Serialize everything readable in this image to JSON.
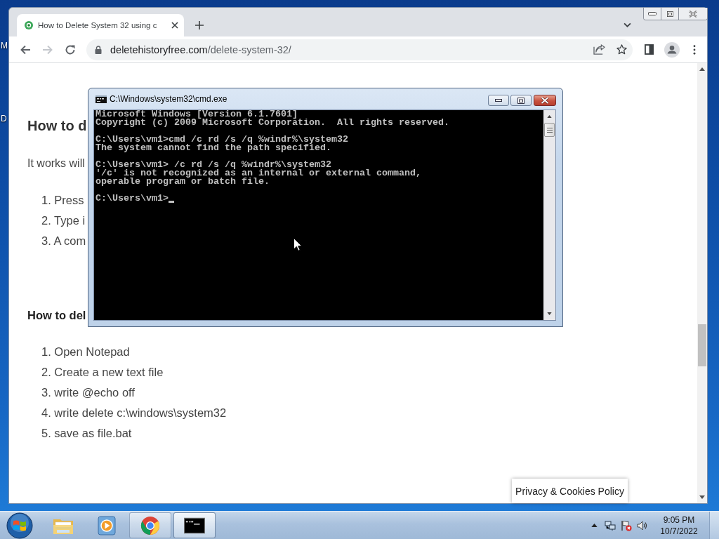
{
  "desktop": {
    "icon_labels": [
      "M",
      "D"
    ]
  },
  "browser": {
    "tabs": [
      {
        "title": "How to Delete System 32 using c",
        "selected": true
      }
    ],
    "nav": [
      {
        "kind": "back",
        "disabled": false
      },
      {
        "kind": "forward",
        "disabled": true
      },
      {
        "kind": "reload",
        "disabled": false
      }
    ],
    "address": {
      "domain": "deletehistoryfree.com",
      "path": "/delete-system-32/"
    },
    "page": {
      "heading_1": "How to d",
      "intro": "It works will",
      "steps_1": [
        "1. Press",
        "2. Type i",
        "3. A com"
      ],
      "heading_2": "How to del",
      "steps_2": [
        "1. Open Notepad",
        "2. Create a new text file",
        "3. write @echo off",
        "4. write delete c:\\windows\\system32",
        "5. save as file.bat"
      ]
    },
    "privacy_button": "Privacy & Cookies Policy"
  },
  "console_window": {
    "title": "C:\\Windows\\system32\\cmd.exe",
    "blocks": [
      [
        "Microsoft Windows [Version 6.1.7601]",
        "Copyright (c) 2009 Microsoft Corporation.  All rights reserved."
      ],
      [
        "C:\\Users\\vm1>cmd /c rd /s /q %windr%\\system32",
        "The system cannot find the path specified."
      ],
      [
        "C:\\Users\\vm1> /c rd /s /q %windr%\\system32",
        "'/c' is not recognized as an internal or external command,",
        "operable program or batch file."
      ]
    ],
    "prompt": "C:\\Users\\vm1>"
  },
  "taskbar": {
    "apps": [
      {
        "kind": "explorer",
        "running": false,
        "selected": false
      },
      {
        "kind": "media",
        "running": false,
        "selected": false
      },
      {
        "kind": "browser",
        "running": true,
        "selected": false
      },
      {
        "kind": "console",
        "running": true,
        "selected": true
      }
    ],
    "time": "9:05 PM",
    "date": "10/7/2022"
  }
}
